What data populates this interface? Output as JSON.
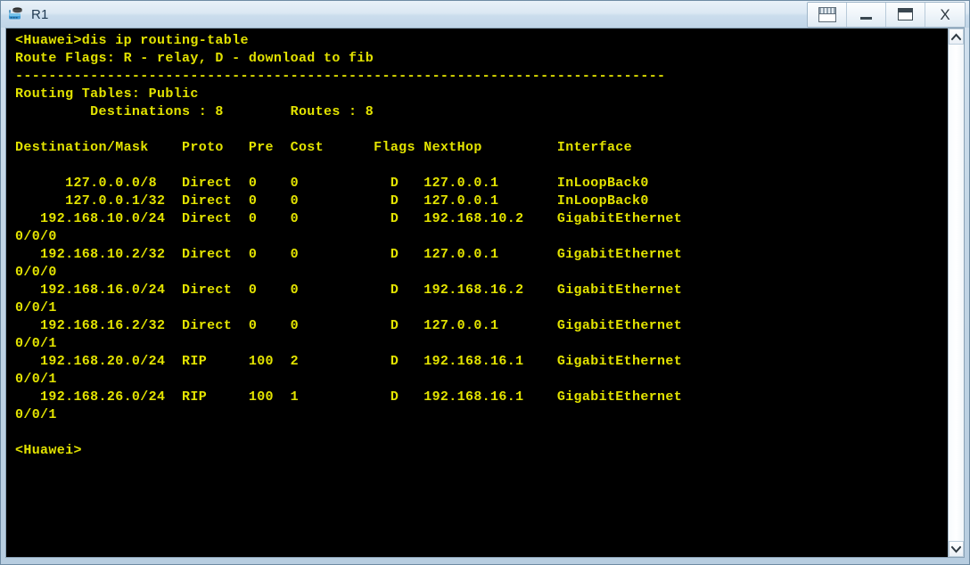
{
  "window": {
    "title": "R1",
    "app_icon": "router-device-icon",
    "controls": [
      {
        "name": "restore-panel-button",
        "icon": "window-panel-icon",
        "label": ""
      },
      {
        "name": "minimize-button",
        "icon": "minimize-icon",
        "label": ""
      },
      {
        "name": "maximize-button",
        "icon": "maximize-icon",
        "label": ""
      },
      {
        "name": "close-button",
        "icon": "close-icon",
        "label": "X"
      }
    ]
  },
  "terminal": {
    "foreground_color": "#e3e300",
    "background_color": "#000000",
    "prompt": "<Huawei>",
    "command": "dis ip routing-table",
    "route_flags_line": "Route Flags: R - relay, D - download to fib",
    "separator": "------------------------------------------------------------------------------",
    "routing_tables_label": "Routing Tables: Public",
    "destinations_label": "Destinations",
    "destinations_count": "8",
    "routes_label": "Routes",
    "routes_count": "8",
    "columns": [
      "Destination/Mask",
      "Proto",
      "Pre",
      "Cost",
      "Flags",
      "NextHop",
      "Interface"
    ],
    "routes": [
      {
        "destination": "127.0.0.0/8",
        "proto": "Direct",
        "pre": "0",
        "cost": "0",
        "flags": "D",
        "nexthop": "127.0.0.1",
        "interface": "InLoopBack0",
        "interface_wrap": ""
      },
      {
        "destination": "127.0.0.1/32",
        "proto": "Direct",
        "pre": "0",
        "cost": "0",
        "flags": "D",
        "nexthop": "127.0.0.1",
        "interface": "InLoopBack0",
        "interface_wrap": ""
      },
      {
        "destination": "192.168.10.0/24",
        "proto": "Direct",
        "pre": "0",
        "cost": "0",
        "flags": "D",
        "nexthop": "192.168.10.2",
        "interface": "GigabitEthernet",
        "interface_wrap": "0/0/0"
      },
      {
        "destination": "192.168.10.2/32",
        "proto": "Direct",
        "pre": "0",
        "cost": "0",
        "flags": "D",
        "nexthop": "127.0.0.1",
        "interface": "GigabitEthernet",
        "interface_wrap": "0/0/0"
      },
      {
        "destination": "192.168.16.0/24",
        "proto": "Direct",
        "pre": "0",
        "cost": "0",
        "flags": "D",
        "nexthop": "192.168.16.2",
        "interface": "GigabitEthernet",
        "interface_wrap": "0/0/1"
      },
      {
        "destination": "192.168.16.2/32",
        "proto": "Direct",
        "pre": "0",
        "cost": "0",
        "flags": "D",
        "nexthop": "127.0.0.1",
        "interface": "GigabitEthernet",
        "interface_wrap": "0/0/1"
      },
      {
        "destination": "192.168.20.0/24",
        "proto": "RIP",
        "pre": "100",
        "cost": "2",
        "flags": "D",
        "nexthop": "192.168.16.1",
        "interface": "GigabitEthernet",
        "interface_wrap": "0/0/1"
      },
      {
        "destination": "192.168.26.0/24",
        "proto": "RIP",
        "pre": "100",
        "cost": "1",
        "flags": "D",
        "nexthop": "192.168.16.1",
        "interface": "GigabitEthernet",
        "interface_wrap": "0/0/1"
      }
    ],
    "trailing_prompt": "<Huawei>",
    "screen_text": "<Huawei>dis ip routing-table\nRoute Flags: R - relay, D - download to fib\n------------------------------------------------------------------------------\nRouting Tables: Public\n         Destinations : 8        Routes : 8\n\nDestination/Mask    Proto   Pre  Cost      Flags NextHop         Interface\n\n      127.0.0.0/8   Direct  0    0           D   127.0.0.1       InLoopBack0\n      127.0.0.1/32  Direct  0    0           D   127.0.0.1       InLoopBack0\n   192.168.10.0/24  Direct  0    0           D   192.168.10.2    GigabitEthernet\n0/0/0\n   192.168.10.2/32  Direct  0    0           D   127.0.0.1       GigabitEthernet\n0/0/0\n   192.168.16.0/24  Direct  0    0           D   192.168.16.2    GigabitEthernet\n0/0/1\n   192.168.16.2/32  Direct  0    0           D   127.0.0.1       GigabitEthernet\n0/0/1\n   192.168.20.0/24  RIP     100  2           D   192.168.16.1    GigabitEthernet\n0/0/1\n   192.168.26.0/24  RIP     100  1           D   192.168.16.1    GigabitEthernet\n0/0/1\n\n<Huawei>"
  },
  "scrollbar": {
    "up_arrow": "chevron-up-icon",
    "down_arrow": "chevron-down-icon"
  }
}
